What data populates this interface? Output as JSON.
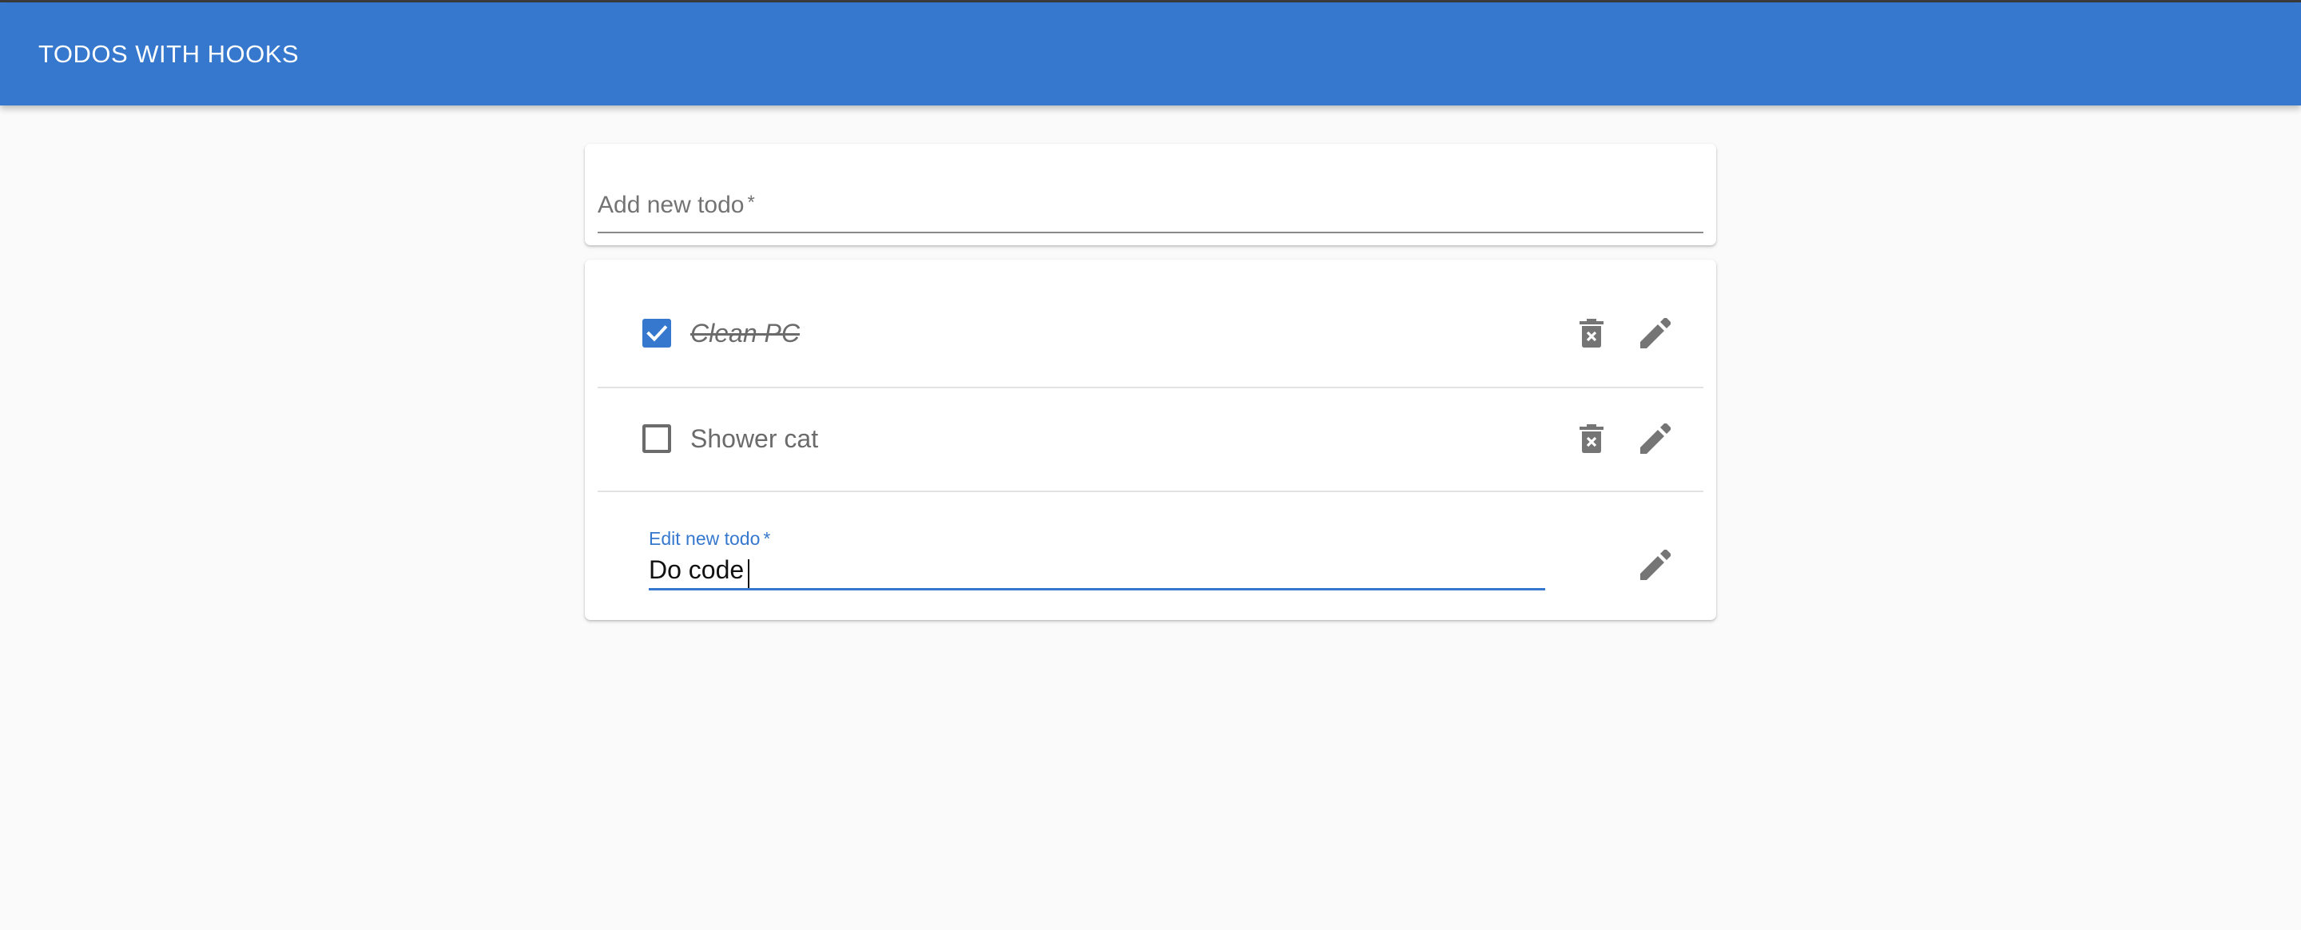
{
  "app": {
    "title": "TODOS WITH HOOKS",
    "accent_color": "#3578cd"
  },
  "add_todo": {
    "label": "Add new todo",
    "required_marker": "*",
    "value": ""
  },
  "todos": [
    {
      "text": "Clean PC",
      "completed": true,
      "delete_icon": "delete-forever-icon",
      "edit_icon": "pencil-icon"
    },
    {
      "text": "Shower cat",
      "completed": false,
      "delete_icon": "delete-forever-icon",
      "edit_icon": "pencil-icon"
    }
  ],
  "editing": {
    "label": "Edit new todo",
    "required_marker": "*",
    "value": "Do code",
    "edit_icon": "pencil-icon"
  }
}
